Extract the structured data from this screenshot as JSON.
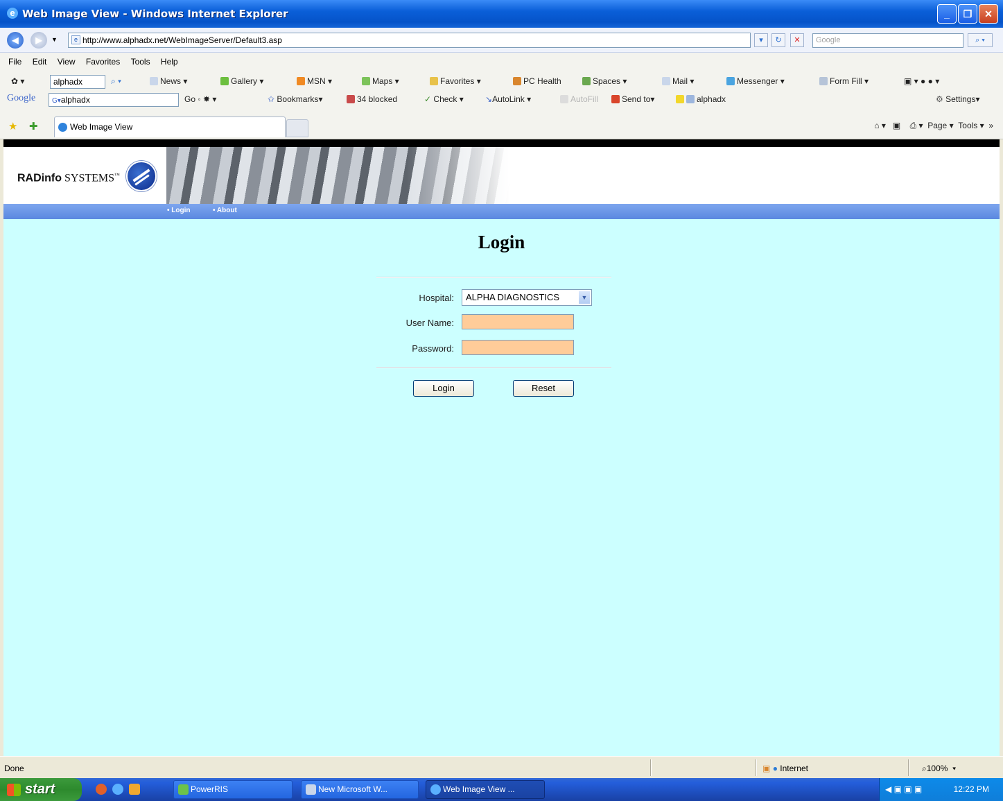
{
  "window": {
    "title": "Web Image View - Windows Internet Explorer",
    "min": "_",
    "max": "❐",
    "close": "✕"
  },
  "address": {
    "url": "http://www.alphadx.net/WebImageServer/Default3.asp",
    "search_placeholder": "Google"
  },
  "menu": [
    "File",
    "Edit",
    "View",
    "Favorites",
    "Tools",
    "Help"
  ],
  "toolbar1": {
    "search_value": "alphadx",
    "items": [
      "News",
      "Gallery",
      "MSN",
      "Maps",
      "Favorites",
      "PC Health",
      "Spaces",
      "Mail",
      "Messenger",
      "Form Fill"
    ]
  },
  "google_toolbar": {
    "logo": "Google",
    "search_value": "alphadx",
    "go": "Go",
    "bookmarks": "Bookmarks",
    "blocked": "34 blocked",
    "check": "Check",
    "autolink": "AutoLink",
    "autofill": "AutoFill",
    "send_to": "Send to",
    "alphadx": "alphadx",
    "settings": "Settings"
  },
  "tabs": {
    "active_tab": "Web Image View",
    "page": "Page",
    "tools": "Tools"
  },
  "page": {
    "logo_bold": "RADinfo",
    "logo_rest": " SYSTEMS",
    "logo_tm": "™",
    "nav": [
      "Login",
      "About"
    ],
    "title": "Login",
    "hospital_label": "Hospital:",
    "hospital_value": "ALPHA DIAGNOSTICS",
    "username_label": "User Name:",
    "password_label": "Password:",
    "login_button": "Login",
    "reset_button": "Reset"
  },
  "status": {
    "text": "Done",
    "zone": "Internet",
    "zoom": "100%"
  },
  "taskbar": {
    "start": "start",
    "items": [
      "PowerRIS",
      "New Microsoft W...",
      "Web Image View ..."
    ],
    "clock": "12:22 PM"
  }
}
